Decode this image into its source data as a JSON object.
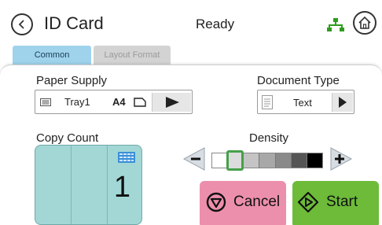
{
  "header": {
    "title": "ID Card",
    "status": "Ready",
    "back_icon": "back-arrow-icon",
    "network_icon": "network-icon",
    "home_icon": "home-icon"
  },
  "tabs": [
    {
      "label": "Common",
      "active": true
    },
    {
      "label": "Layout Format",
      "active": false
    }
  ],
  "paper_supply": {
    "label": "Paper Supply",
    "tray": "Tray1",
    "size": "A4"
  },
  "document_type": {
    "label": "Document Type",
    "value": "Text"
  },
  "copy_count": {
    "label": "Copy Count",
    "value": "1"
  },
  "density": {
    "label": "Density",
    "level": 2,
    "levels": 7,
    "colors": [
      "#ffffff",
      "#dcdcdc",
      "#c4c4c4",
      "#a8a8a8",
      "#8a8a8a",
      "#555555",
      "#000000"
    ]
  },
  "actions": {
    "cancel_label": "Cancel",
    "start_label": "Start"
  },
  "colors": {
    "tab_active": "#9fd3ec",
    "tab_inactive": "#d3d3d3",
    "copy_box": "#a2d7d6",
    "cancel": "#ec8fac",
    "start": "#6dbb39",
    "network": "#2e9c1f",
    "marker": "#46a04a"
  }
}
